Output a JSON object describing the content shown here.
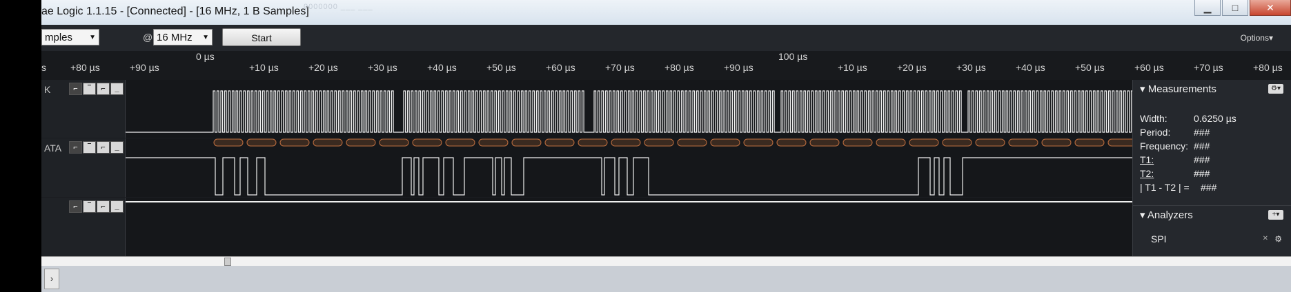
{
  "window": {
    "title": "ae Logic 1.1.15 - [Connected] - [16 MHz, 1 B Samples]",
    "ghost_text": "0000000 ___ ___",
    "minimize": "▁",
    "maximize": "□",
    "close": "✕"
  },
  "toolbar": {
    "samples_value": "mples",
    "at": "@",
    "rate_value": "16 MHz",
    "start_label": "Start",
    "options_label": "Options▾"
  },
  "ruler": {
    "left_ticks": [
      "+80 µs",
      "+90 µs"
    ],
    "zero_label": "0 µs",
    "mid_ticks": [
      "+10 µs",
      "+20 µs",
      "+30 µs",
      "+40 µs",
      "+50 µs",
      "+60 µs",
      "+70 µs",
      "+80 µs",
      "+90 µs"
    ],
    "hundred_label": "100 µs",
    "right_ticks": [
      "+10 µs",
      "+20 µs",
      "+30 µs",
      "+40 µs",
      "+50 µs",
      "+60 µs",
      "+70 µs",
      "+80 µs"
    ],
    "left_edge": "s"
  },
  "channels": [
    {
      "name": "K",
      "trigger_icons": [
        "⌐",
        "‾",
        "⌐",
        "_"
      ]
    },
    {
      "name": "ATA",
      "trigger_icons": [
        "⌐",
        "‾",
        "⌐",
        "_"
      ]
    },
    {
      "name": "",
      "trigger_icons": [
        "⌐",
        "‾",
        "⌐",
        "_"
      ]
    }
  ],
  "measurements": {
    "header": "Measurements",
    "rows": [
      {
        "key": "Width:",
        "value": "0.6250 µs"
      },
      {
        "key": "Period:",
        "value": "###"
      },
      {
        "key": "Frequency:",
        "value": "###"
      },
      {
        "key": "T1:",
        "value": "###"
      },
      {
        "key": "T2:",
        "value": "###"
      },
      {
        "key": "| T1 - T2 | =",
        "value": "###"
      }
    ],
    "gear_label": "⚙▾"
  },
  "analyzers": {
    "header": "Analyzers",
    "add_label": "+▾",
    "items": [
      {
        "name": "SPI"
      }
    ]
  },
  "colors": {
    "trace": "#f0f0f0",
    "decode_bubble": "#3a2a20",
    "decode_border": "#c07040",
    "background": "#15171a"
  },
  "status": {
    "expand": "›"
  }
}
